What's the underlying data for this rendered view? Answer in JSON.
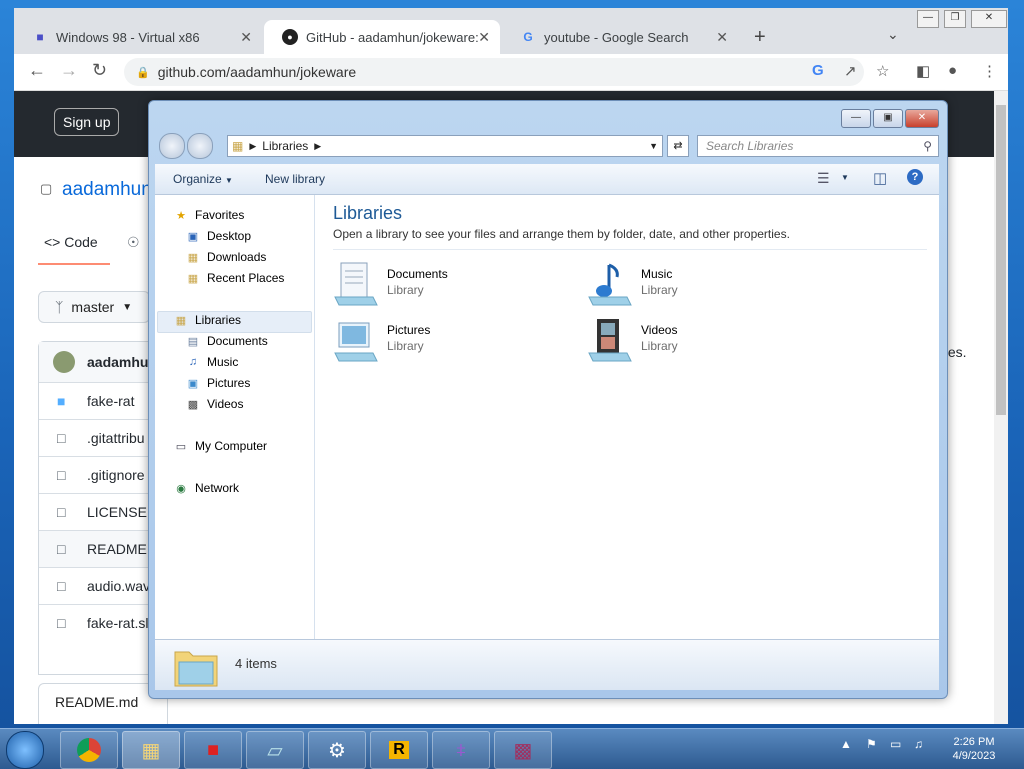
{
  "browser": {
    "tabs": [
      {
        "label": "Windows 98 - Virtual x86",
        "icon": "app-icon"
      },
      {
        "label": "GitHub - aadamhun/jokeware: A",
        "icon": "github-icon"
      },
      {
        "label": "youtube - Google Search",
        "icon": "google-icon"
      }
    ],
    "url": "github.com/aadamhun/jokeware"
  },
  "github": {
    "sign_up": "Sign up",
    "repo_owner": "aadamhun",
    "code_tab": "Code",
    "branch": "master",
    "commit_author": "aadamhun",
    "files": [
      {
        "name": "fake-rat",
        "type": "folder"
      },
      {
        "name": ".gitattribu",
        "type": "file"
      },
      {
        "name": ".gitignore",
        "type": "file"
      },
      {
        "name": "LICENSE",
        "type": "file"
      },
      {
        "name": "README.r",
        "type": "file"
      },
      {
        "name": "audio.wav",
        "type": "file"
      },
      {
        "name": "fake-rat.sl",
        "type": "file"
      }
    ],
    "readme_label": "README.md",
    "fragment_text": "tes."
  },
  "explorer": {
    "address_root": "Libraries",
    "search_placeholder": "Search Libraries",
    "organize": "Organize",
    "new_library": "New library",
    "nav": {
      "favorites": "Favorites",
      "favorites_items": [
        "Desktop",
        "Downloads",
        "Recent Places"
      ],
      "libraries": "Libraries",
      "libraries_items": [
        "Documents",
        "Music",
        "Pictures",
        "Videos"
      ],
      "my_computer": "My Computer",
      "network": "Network"
    },
    "title": "Libraries",
    "description": "Open a library to see your files and arrange them by folder, date, and other properties.",
    "libraries": [
      {
        "name": "Documents",
        "type": "Library",
        "icon": "documents-library-icon"
      },
      {
        "name": "Music",
        "type": "Library",
        "icon": "music-library-icon"
      },
      {
        "name": "Pictures",
        "type": "Library",
        "icon": "pictures-library-icon"
      },
      {
        "name": "Videos",
        "type": "Library",
        "icon": "videos-library-icon"
      }
    ],
    "item_count": "4 items"
  },
  "taskbar": {
    "time": "2:26 PM",
    "date": "4/9/2023"
  }
}
